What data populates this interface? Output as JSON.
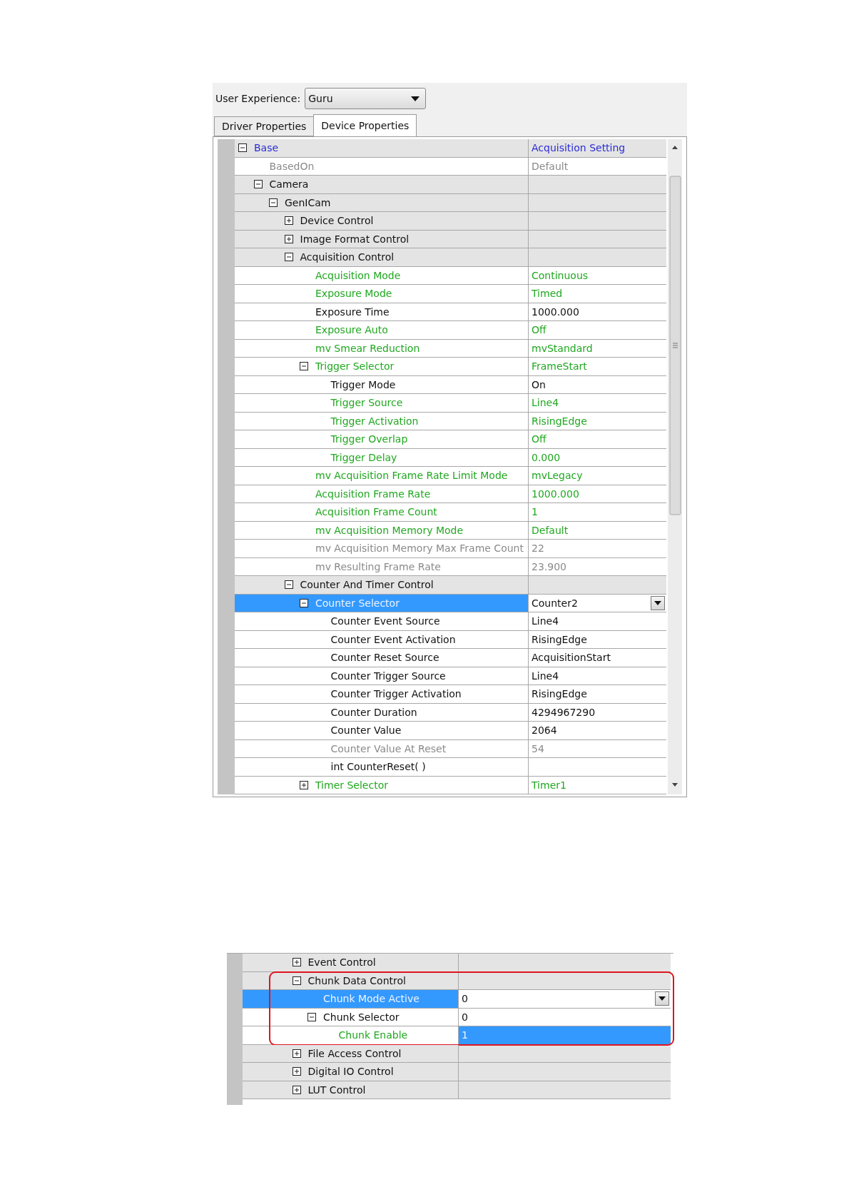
{
  "toolbar": {
    "label": "User Experience:",
    "dropdown": {
      "value": "Guru"
    }
  },
  "tabs": [
    {
      "label": "Driver Properties",
      "selected": false
    },
    {
      "label": "Device Properties",
      "selected": true
    }
  ],
  "grid": {
    "rows": [
      {
        "label": "Base",
        "value": "Acquisition Setting",
        "kind": "root",
        "expanded": true,
        "selected": false,
        "children": [
          {
            "label": "BasedOn",
            "value": "Default",
            "kind": "readonly",
            "selected": false
          },
          {
            "label": "Camera",
            "kind": "group",
            "expanded": true,
            "selected": false,
            "children": [
              {
                "label": "GenICam",
                "kind": "group",
                "expanded": true,
                "selected": false,
                "children": [
                  {
                    "label": "Device Control",
                    "kind": "group",
                    "expanded": false,
                    "selected": false
                  },
                  {
                    "label": "Image Format Control",
                    "kind": "group",
                    "expanded": false,
                    "selected": false
                  },
                  {
                    "label": "Acquisition Control",
                    "kind": "group",
                    "expanded": true,
                    "selected": false,
                    "children": [
                      {
                        "label": "Acquisition Mode",
                        "value": "Continuous",
                        "kind": "modified",
                        "selected": false
                      },
                      {
                        "label": "Exposure Mode",
                        "value": "Timed",
                        "kind": "modified",
                        "selected": false
                      },
                      {
                        "label": "Exposure Time",
                        "value": "1000.000",
                        "kind": "normal",
                        "selected": false
                      },
                      {
                        "label": "Exposure Auto",
                        "value": "Off",
                        "kind": "modified",
                        "selected": false
                      },
                      {
                        "label": "mv Smear Reduction",
                        "value": "mvStandard",
                        "kind": "modified",
                        "selected": false
                      },
                      {
                        "label": "Trigger Selector",
                        "value": "FrameStart",
                        "kind": "modified",
                        "expanded": true,
                        "selected": false,
                        "children": [
                          {
                            "label": "Trigger Mode",
                            "value": "On",
                            "kind": "normal",
                            "selected": false
                          },
                          {
                            "label": "Trigger Source",
                            "value": "Line4",
                            "kind": "modified",
                            "selected": false
                          },
                          {
                            "label": "Trigger Activation",
                            "value": "RisingEdge",
                            "kind": "modified",
                            "selected": false
                          },
                          {
                            "label": "Trigger Overlap",
                            "value": "Off",
                            "kind": "modified",
                            "selected": false
                          },
                          {
                            "label": "Trigger Delay",
                            "value": "0.000",
                            "kind": "modified",
                            "selected": false
                          }
                        ]
                      },
                      {
                        "label": "mv Acquisition Frame Rate Limit Mode",
                        "value": "mvLegacy",
                        "kind": "modified",
                        "selected": false
                      },
                      {
                        "label": "Acquisition Frame Rate",
                        "value": "1000.000",
                        "kind": "modified",
                        "selected": false
                      },
                      {
                        "label": "Acquisition Frame Count",
                        "value": "1",
                        "kind": "modified",
                        "selected": false
                      },
                      {
                        "label": "mv Acquisition Memory Mode",
                        "value": "Default",
                        "kind": "modified",
                        "selected": false
                      },
                      {
                        "label": "mv Acquisition Memory Max Frame Count",
                        "value": "22",
                        "kind": "readonly",
                        "selected": false
                      },
                      {
                        "label": "mv Resulting Frame Rate",
                        "value": "23.900",
                        "kind": "readonly",
                        "selected": false
                      }
                    ]
                  },
                  {
                    "label": "Counter And Timer Control",
                    "kind": "group",
                    "expanded": true,
                    "selected": false,
                    "children": [
                      {
                        "label": "Counter Selector",
                        "value": "Counter2",
                        "kind": "modified",
                        "expanded": true,
                        "selected": true,
                        "dropdown": true,
                        "children": [
                          {
                            "label": "Counter Event Source",
                            "value": "Line4",
                            "kind": "normal",
                            "selected": false
                          },
                          {
                            "label": "Counter Event Activation",
                            "value": "RisingEdge",
                            "kind": "normal",
                            "selected": false
                          },
                          {
                            "label": "Counter Reset Source",
                            "value": "AcquisitionStart",
                            "kind": "normal",
                            "selected": false
                          },
                          {
                            "label": "Counter Trigger Source",
                            "value": "Line4",
                            "kind": "normal",
                            "selected": false
                          },
                          {
                            "label": "Counter Trigger Activation",
                            "value": "RisingEdge",
                            "kind": "normal",
                            "selected": false
                          },
                          {
                            "label": "Counter Duration",
                            "value": "4294967290",
                            "kind": "normal",
                            "selected": false
                          },
                          {
                            "label": "Counter Value",
                            "value": "2064",
                            "kind": "normal",
                            "selected": false
                          },
                          {
                            "label": "Counter Value At Reset",
                            "value": "54",
                            "kind": "readonly",
                            "selected": false
                          },
                          {
                            "label": "int CounterReset( )",
                            "kind": "normal",
                            "selected": false
                          }
                        ]
                      },
                      {
                        "label": "Timer Selector",
                        "value": "Timer1",
                        "kind": "modified",
                        "expanded": false,
                        "selected": false
                      }
                    ]
                  }
                ]
              }
            ]
          }
        ]
      }
    ]
  },
  "grid_2": {
    "rows": [
      {
        "label": "Event Control",
        "kind": "group",
        "expanded": false,
        "selected": false
      },
      {
        "label": "Chunk Data Control",
        "kind": "group",
        "expanded": true,
        "selected": false,
        "outlined": true,
        "children": [
          {
            "label": "Chunk Mode Active",
            "value": "0",
            "kind": "modified",
            "selected": true,
            "dropdown": true
          },
          {
            "label": "Chunk Selector",
            "value": "0",
            "kind": "normal",
            "expanded": true,
            "selected": false,
            "children": [
              {
                "label": "Chunk Enable",
                "value": "1",
                "kind": "modified",
                "selected": false,
                "value_selected": true
              }
            ]
          }
        ]
      },
      {
        "label": "File Access Control",
        "kind": "group",
        "expanded": false,
        "selected": false
      },
      {
        "label": "Digital IO Control",
        "kind": "group",
        "expanded": false,
        "selected": false
      },
      {
        "label": "LUT Control",
        "kind": "group",
        "expanded": false,
        "selected": false
      }
    ]
  }
}
